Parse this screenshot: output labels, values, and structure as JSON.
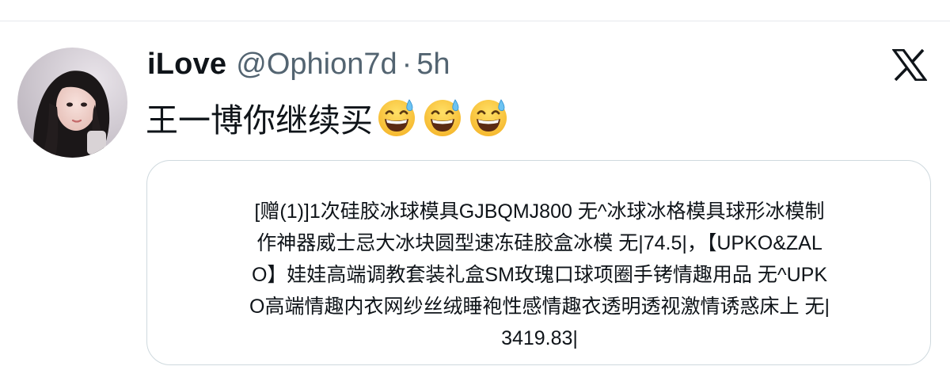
{
  "tweet": {
    "display_name": "iLove",
    "handle": "@Ophion7d",
    "separator": "·",
    "time": "5h",
    "text": "王一博你继续买",
    "emoji_count": 3,
    "emoji_name": "grinning-face-with-sweat"
  },
  "card": {
    "lines": [
      "[赠(1)]1次硅胶冰球模具GJBQMJ800 无^冰球冰格模具球形冰模制",
      "作神器威士忌大冰块圆型速冻硅胶盒冰模 无|74.5|，【UPKO&ZAL",
      "O】娃娃高端调教套装礼盒SM玫瑰口球项圈手铐情趣用品 无^UPK",
      "O高端情趣内衣网纱丝绒睡袍性感情趣衣透明透视激情诱惑床上 无|",
      "3419.83|"
    ]
  },
  "colors": {
    "text_primary": "#0f1419",
    "text_secondary": "#536471",
    "border": "#cfd9de"
  },
  "icons": [
    "x-logo-icon",
    "grinning-face-with-sweat-icon"
  ]
}
